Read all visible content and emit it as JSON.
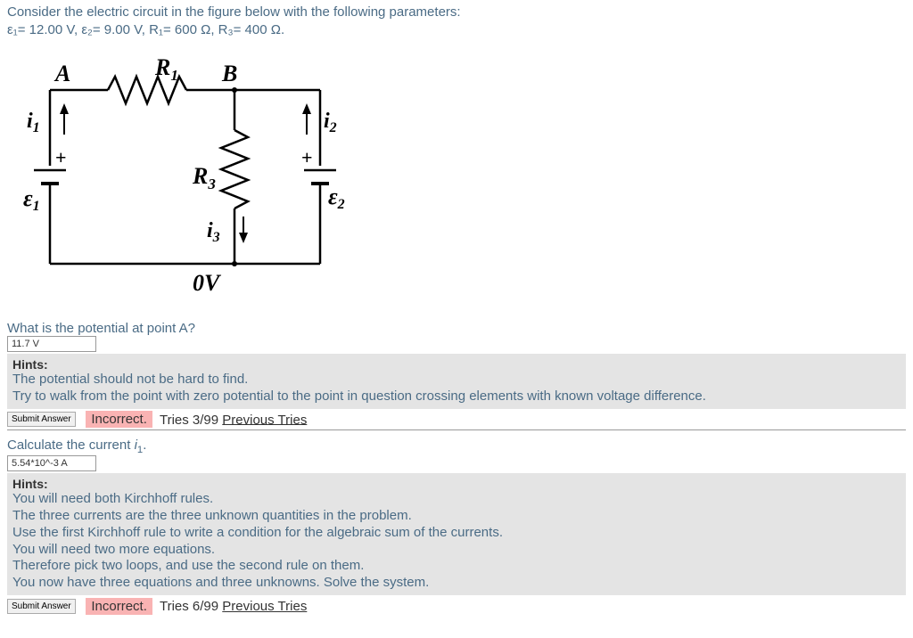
{
  "intro": {
    "line1_prefix": "Consider the electric circuit in the figure below with the following parameters:",
    "line2": "ε₁= 12.00 V, ε₂= 9.00 V, R₁= 600 Ω, R₃= 400 Ω."
  },
  "labels": {
    "A": "A",
    "B": "B",
    "R1": "R",
    "R1_sub": "1",
    "R3": "R",
    "R3_sub": "3",
    "i1": "i",
    "i1_sub": "1",
    "i2": "i",
    "i2_sub": "2",
    "i3": "i",
    "i3_sub": "3",
    "e1": "ε",
    "e1_sub": "1",
    "e2": "ε",
    "e2_sub": "2",
    "ov": "0V"
  },
  "q1": {
    "question_prefix": "What is the potential at point A?",
    "answer_value": "11.7 V",
    "hints_label": "Hints:",
    "hint1": "The potential should not be hard to find.",
    "hint2": "Try to walk from the point with zero potential to the point in question crossing elements with known voltage difference.",
    "submit": "Submit Answer",
    "status": "Incorrect.",
    "tries_prefix": "Tries 3/99 ",
    "tries_link": "Previous Tries"
  },
  "q2": {
    "question_prefix": "Calculate the current ",
    "question_var": "i",
    "question_sub": "1",
    "question_suffix": ".",
    "answer_value": "5.54*10^-3 A",
    "hints_label": "Hints:",
    "hint1": "You will need both Kirchhoff rules.",
    "hint2": "The three currents are the three unknown quantities in the problem.",
    "hint3": "Use the first Kirchhoff rule to write a condition for the algebraic sum of the currents.",
    "hint4": "You will need two more equations.",
    "hint5": "Therefore pick two loops, and use the second rule on them.",
    "hint6": "You now have three equations and three unknowns. Solve the system.",
    "submit": "Submit Answer",
    "status": "Incorrect.",
    "tries_prefix": "Tries 6/99 ",
    "tries_link": "Previous Tries"
  }
}
